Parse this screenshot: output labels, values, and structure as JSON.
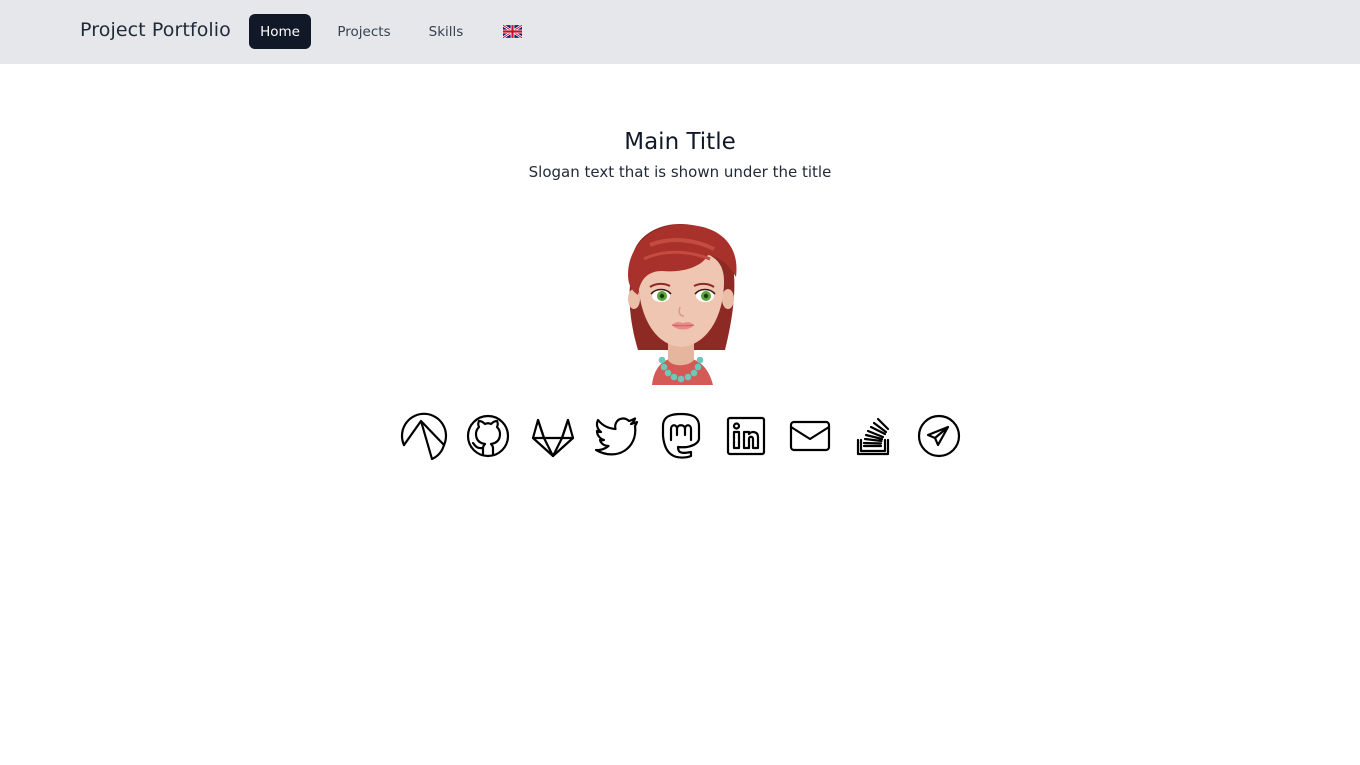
{
  "navbar": {
    "brand": "Project Portfolio",
    "items": [
      {
        "label": "Home",
        "active": true
      },
      {
        "label": "Projects",
        "active": false
      },
      {
        "label": "Skills",
        "active": false
      }
    ],
    "language": {
      "icon": "uk-flag-icon",
      "code": "en-GB"
    },
    "colors": {
      "background": "#e5e7eb",
      "active_bg": "#111827",
      "active_text": "#ffffff"
    }
  },
  "hero": {
    "title": "Main Title",
    "slogan": "Slogan text that is shown under the title",
    "avatar": "cartoon-woman-avatar"
  },
  "socials": [
    {
      "name": "mountain-logo",
      "icon": "mountain-circle-icon"
    },
    {
      "name": "github",
      "icon": "github-icon"
    },
    {
      "name": "gitlab",
      "icon": "gitlab-icon"
    },
    {
      "name": "twitter",
      "icon": "twitter-icon"
    },
    {
      "name": "mastodon",
      "icon": "mastodon-icon"
    },
    {
      "name": "linkedin",
      "icon": "linkedin-icon"
    },
    {
      "name": "email",
      "icon": "mail-icon"
    },
    {
      "name": "stackoverflow",
      "icon": "stackoverflow-icon"
    },
    {
      "name": "telegram",
      "icon": "telegram-icon"
    }
  ]
}
